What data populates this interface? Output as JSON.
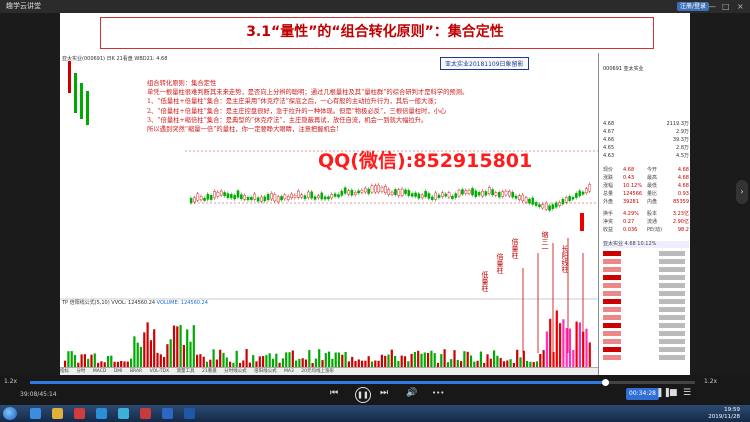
{
  "titlebar": {
    "app_name": "趣学云讲堂",
    "login_label": "注册/登录"
  },
  "slide": {
    "title": "3.1“量性”的“组合转化原则”：集合定性",
    "stock_info": "亚太实业(000691) 日K 21看盘   WBD21: 4.68",
    "price_labels": [
      "6.84",
      "4.6",
      "20",
      "21"
    ],
    "stamp": "亚太实业20181109日象留影",
    "notes": [
      "组合转化原则：集合定性",
      "单凭一根量柱很难判断其未来走势，是否向上分辨的聪明；通过几根量柱及其“量柱群”的综合研判才是科学的预测。",
      "1、“低量柱+倍量柱”集合：是主庄采用“休克疗法”探底之后，一心有般的主动拉升行为，其后一般大涨；",
      "2、“倍量柱+倍量柱”集合：是主庄控盘很好，急于拉升的一种体现。但是“物极必反”，三根倍量柱时，小心",
      "3、“倍量柱+缩倍柱”集合：是典型的“休克疗法”，主庄隐蔽再试，放任自流，机会一到就大幅拉升。",
      "所以遇到突然“缩量一倍”的量柱，你一定要睁大眼睛，注意把握机会!"
    ],
    "watermark": "QQ(微信):852915801",
    "annotations": [
      "低量柱",
      "倍量柱",
      "倍量柱",
      "缩三一",
      "长阳线柱"
    ],
    "indicator_label": "TP 倍阳线公式(5,10)  VVOL: 124560.24",
    "indicator_vol": "VOLUME: 124560.24",
    "date_label": "2018年09月1日",
    "tabs": [
      "指标",
      "分时",
      "MACD",
      "DMI",
      "BRAR",
      "VOL-TDX",
      "测量工具",
      "21看盘",
      "分时线公式",
      "倍阳线公式",
      "MA3",
      "20元均线上涨形",
      "参数"
    ]
  },
  "quote_panel": {
    "code": "000691 亚太实业",
    "asks": [
      {
        "label": "4.68",
        "vol": "2119.3万"
      },
      {
        "label": "4.67",
        "vol": "2.9万"
      },
      {
        "label": "4.66",
        "vol": "39.3万"
      },
      {
        "label": "4.65",
        "vol": "2.8万"
      },
      {
        "label": "4.63",
        "vol": "4.5万"
      }
    ],
    "rows": [
      {
        "l": "现价",
        "v": "4.68",
        "l2": "今开",
        "v2": "4.68"
      },
      {
        "l": "涨跌",
        "v": "0.43",
        "l2": "最高",
        "v2": "4.68"
      },
      {
        "l": "涨幅",
        "v": "10.12%",
        "l2": "最低",
        "v2": "4.68"
      },
      {
        "l": "总量",
        "v": "124566",
        "l2": "量比",
        "v2": "0.93"
      },
      {
        "l": "外盘",
        "v": "39281",
        "l2": "内盘",
        "v2": "85359"
      },
      {
        "l": "换手",
        "v": "4.29%",
        "l2": "股本",
        "v2": "3.23亿"
      },
      {
        "l": "净资",
        "v": "0.27",
        "l2": "流通",
        "v2": "2.90亿"
      },
      {
        "l": "收益",
        "v": "0.036",
        "l2": "PE(动)",
        "v2": "98.2"
      }
    ],
    "footer": "亚太实业 4.68 10.12%"
  },
  "player": {
    "current_time": "00:34:28",
    "elapsed": "39:08/45:14",
    "speed_left": "1.2x",
    "speed_right": "1.2x",
    "progress": 0.8651
  },
  "taskbar": {
    "time": "19:59",
    "date": "2019/11/28"
  }
}
